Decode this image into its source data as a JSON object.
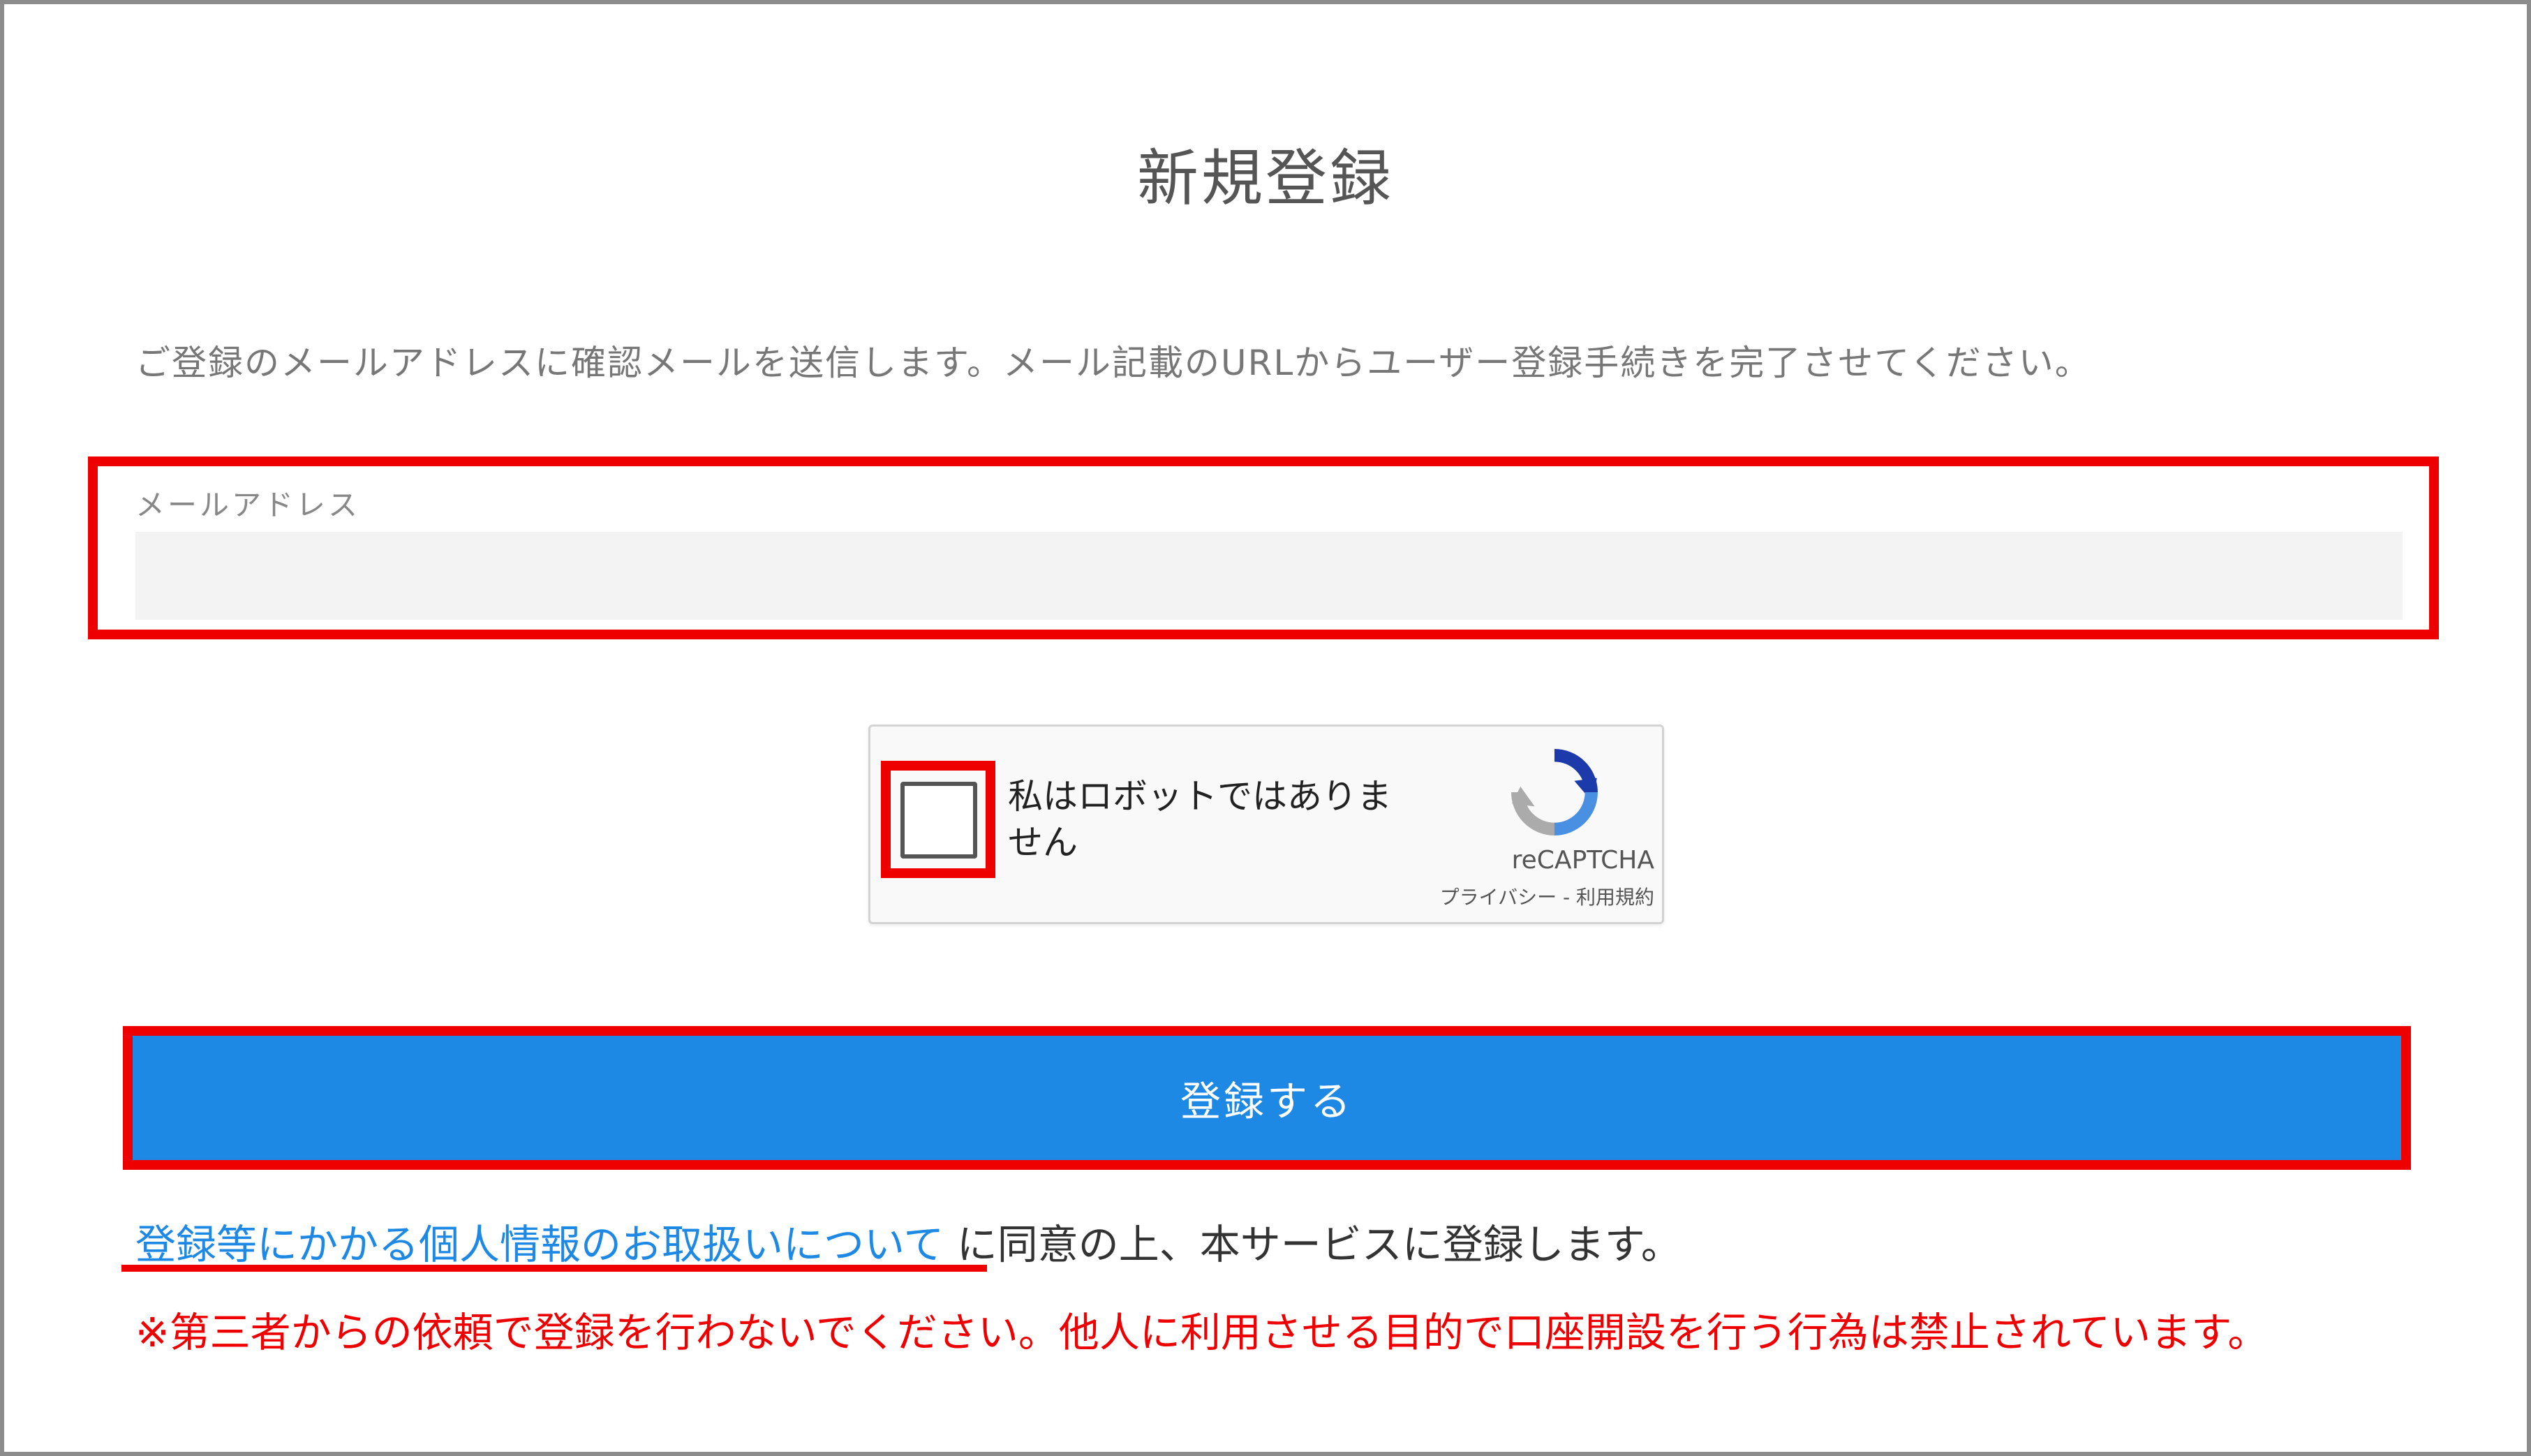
{
  "page": {
    "title": "新規登録",
    "description": "ご登録のメールアドレスに確認メールを送信します。メール記載のURLからユーザー登録手続きを完了させてください。"
  },
  "email_field": {
    "label": "メールアドレス",
    "value": "",
    "placeholder": ""
  },
  "recaptcha": {
    "checkbox_label": "私はロボットではありません",
    "checked": false,
    "brand": "reCAPTCHA",
    "privacy_link": "プライバシー",
    "separator": " - ",
    "terms_link": "利用規約",
    "icon": "recaptcha-logo-icon"
  },
  "submit": {
    "label": "登録する"
  },
  "consent": {
    "link_text": "登録等にかかる個人情報のお取扱いについて",
    "text": " に同意の上、本サービスに登録します。"
  },
  "warning": {
    "text": "※第三者からの依頼で登録を行わないでください。他人に利用させる目的で口座開設を行う行為は禁止されています。"
  },
  "colors": {
    "highlight": "#ee0000",
    "button": "#1e88e5",
    "link": "#1e88e5",
    "warning": "#ee0000"
  }
}
